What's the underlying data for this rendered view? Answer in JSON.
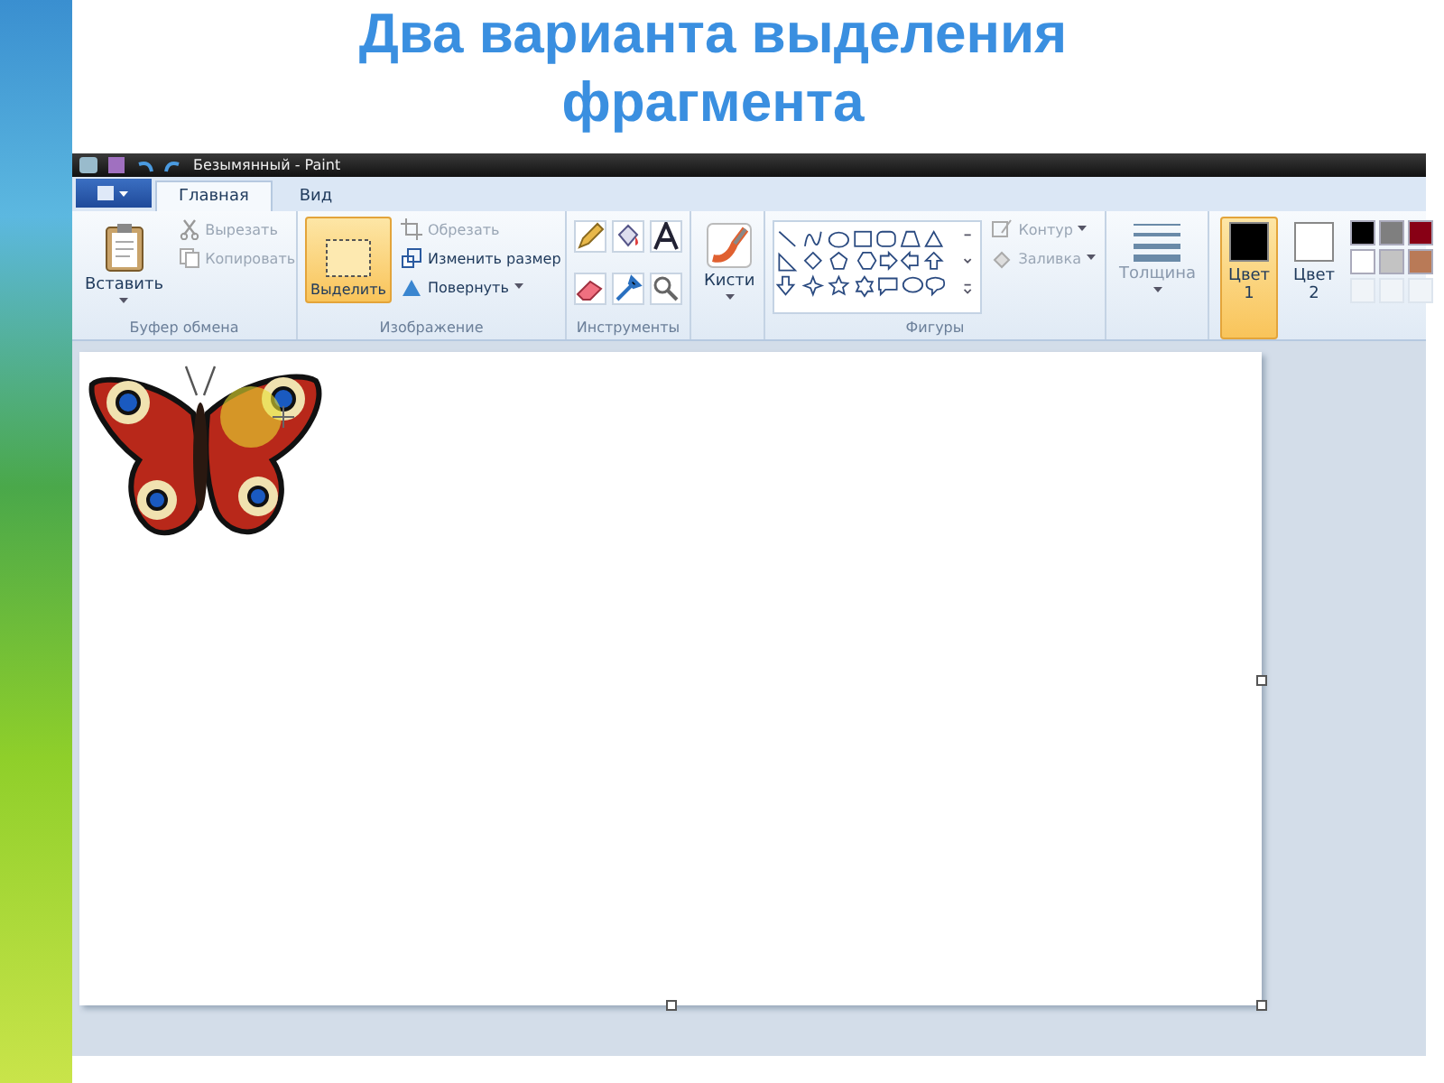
{
  "slide_title": "Два варианта выделения фрагмента",
  "window": {
    "title": "Безымянный - Paint"
  },
  "tabs": [
    {
      "label": "Главная",
      "selected": true
    },
    {
      "label": "Вид",
      "selected": false
    }
  ],
  "clipboard": {
    "label": "Буфер обмена",
    "paste": "Вставить",
    "cut": {
      "label": "Вырезать",
      "disabled": true
    },
    "copy": {
      "label": "Копировать",
      "disabled": true
    }
  },
  "image": {
    "label": "Изображение",
    "select": {
      "label": "Выделить",
      "selected": true
    },
    "crop": {
      "label": "Обрезать",
      "disabled": true
    },
    "resize": {
      "label": "Изменить размер",
      "disabled": false
    },
    "rotate": {
      "label": "Повернуть",
      "disabled": false
    }
  },
  "tools": {
    "label": "Инструменты"
  },
  "brushes": {
    "label": "Кисти"
  },
  "shapes": {
    "label": "Фигуры",
    "outline": {
      "label": "Контур",
      "disabled": true
    },
    "fill": {
      "label": "Заливка",
      "disabled": true
    }
  },
  "size": {
    "label": "Толщина"
  },
  "colors": [
    {
      "label": "Цвет 1",
      "color": "#000000",
      "selected": true
    },
    {
      "label": "Цвет 2",
      "color": "#ffffff",
      "selected": false
    }
  ],
  "palette": [
    {
      "color": "#000000"
    },
    {
      "color": "#7f7f7f"
    },
    {
      "color": "#880015"
    },
    {
      "color": "#ffffff"
    },
    {
      "color": "#c3c3c3"
    },
    {
      "color": "#b97a57"
    }
  ]
}
